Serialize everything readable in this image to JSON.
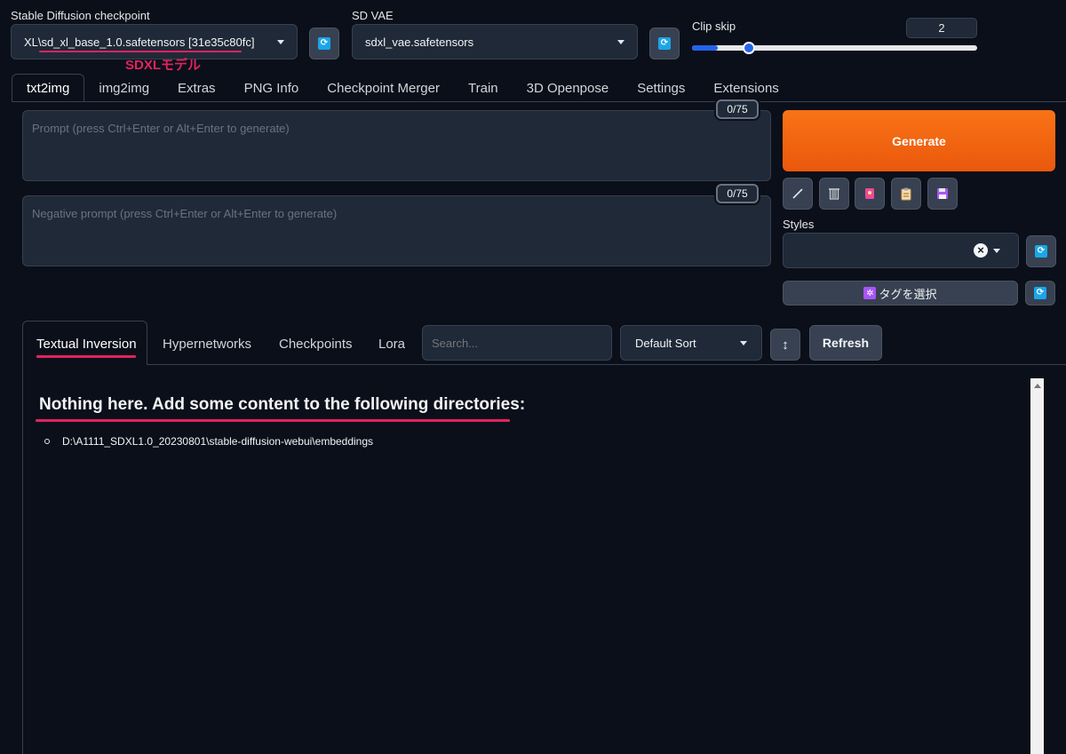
{
  "checkpoint": {
    "label": "Stable Diffusion checkpoint",
    "value": "XL\\sd_xl_base_1.0.safetensors [31e35c80fc]",
    "annotation": "SDXLモデル"
  },
  "vae": {
    "label": "SD VAE",
    "value": "sdxl_vae.safetensors"
  },
  "clip_skip": {
    "label": "Clip skip",
    "value": "2",
    "min": 1,
    "max": 12,
    "current": 2
  },
  "tabs": [
    {
      "label": "txt2img",
      "active": true
    },
    {
      "label": "img2img"
    },
    {
      "label": "Extras"
    },
    {
      "label": "PNG Info"
    },
    {
      "label": "Checkpoint Merger"
    },
    {
      "label": "Train"
    },
    {
      "label": "3D Openpose"
    },
    {
      "label": "Settings"
    },
    {
      "label": "Extensions"
    }
  ],
  "prompt": {
    "placeholder": "Prompt (press Ctrl+Enter or Alt+Enter to generate)",
    "counter": "0/75"
  },
  "negative_prompt": {
    "placeholder": "Negative prompt (press Ctrl+Enter or Alt+Enter to generate)",
    "counter": "0/75"
  },
  "generate": {
    "label": "Generate"
  },
  "styles": {
    "label": "Styles",
    "clear_glyph": "×"
  },
  "tag_select": {
    "label": "タグを選択"
  },
  "extra_tabs": [
    {
      "label": "Textual Inversion",
      "active": true
    },
    {
      "label": "Hypernetworks"
    },
    {
      "label": "Checkpoints"
    },
    {
      "label": "Lora"
    }
  ],
  "search": {
    "placeholder": "Search..."
  },
  "sort": {
    "value": "Default Sort"
  },
  "sort_dir": {
    "glyph": "↕"
  },
  "refresh": {
    "label": "Refresh"
  },
  "empty": {
    "heading": "Nothing here. Add some content to the following directories:",
    "dirs": [
      "D:\\A1111_SDXL1.0_20230801\\stable-diffusion-webui\\embeddings"
    ]
  },
  "colors": {
    "background": "#0b0f19",
    "panel": "#1f2937",
    "accent_orange": "#f97316",
    "accent_blue": "#1ba6e8",
    "annotation_red": "#e0245e"
  }
}
